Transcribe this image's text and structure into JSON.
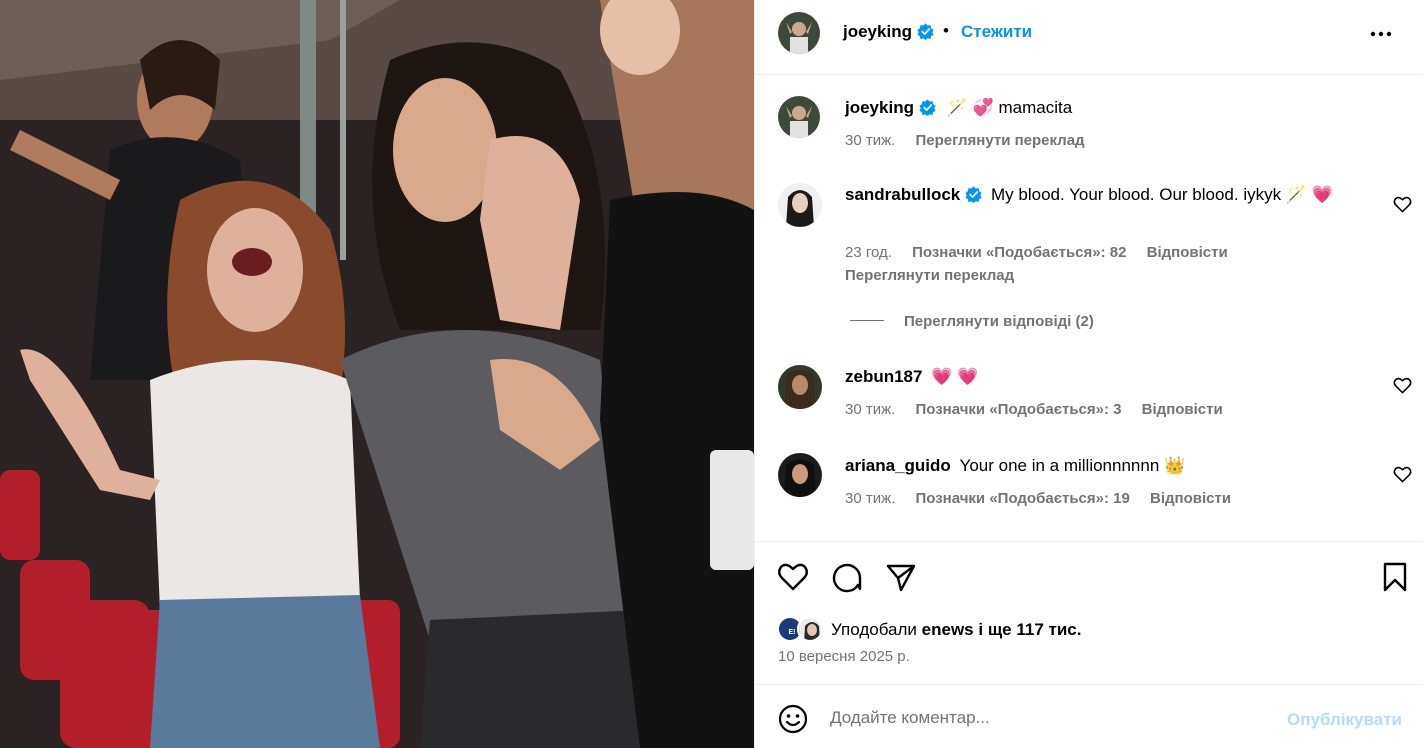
{
  "post": {
    "username": "joeyking",
    "follow_label": "Стежити",
    "separator": "•",
    "caption": {
      "username": "joeyking",
      "text": "🪄 💞 mamacita",
      "time": "30 тиж.",
      "translate": "Переглянути переклад"
    },
    "comments": [
      {
        "username": "sandrabullock",
        "verified": true,
        "text": "My blood. Your blood. Our blood. iykyk 🪄 💗",
        "time": "23 год.",
        "likes": "Позначки «Подобається»: 82",
        "reply": "Відповісти",
        "translate": "Переглянути переклад",
        "view_replies": "Переглянути відповіді (2)"
      },
      {
        "username": "zebun187",
        "verified": false,
        "text": "💗 💗",
        "time": "30 тиж.",
        "likes": "Позначки «Подобається»: 3",
        "reply": "Відповісти"
      },
      {
        "username": "ariana_guido",
        "verified": false,
        "text": "Your one in a millionnnnnn 👑",
        "time": "30 тиж.",
        "likes": "Позначки «Подобається»: 19",
        "reply": "Відповісти"
      }
    ],
    "likes_summary": {
      "prefix": "Уподобали",
      "user": "enews",
      "suffix": "і ще 117 тис."
    },
    "date": "10 вересня 2025 р.",
    "composer": {
      "placeholder": "Додайте коментар...",
      "post_label": "Опублікувати"
    }
  },
  "icons": {
    "verified_color": "#0095f6",
    "follow_color": "#0095f6",
    "names": [
      "verified-badge-icon",
      "more-options-icon",
      "heart-icon",
      "comment-icon",
      "share-icon",
      "bookmark-icon",
      "emoji-icon"
    ]
  }
}
